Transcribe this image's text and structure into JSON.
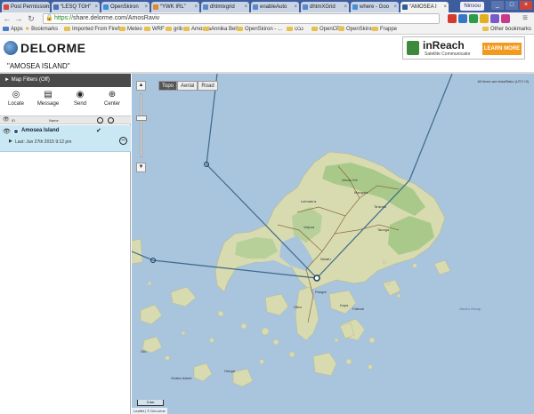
{
  "browser": {
    "tabs": [
      {
        "label": "Post Permissions",
        "color": "#d9463c"
      },
      {
        "label": "“LESQ TGH”",
        "color": "#4a6fb5"
      },
      {
        "label": "OpenSkiron",
        "color": "#3a8fd6"
      },
      {
        "label": "“YWK IRL”",
        "color": "#e08a2a"
      },
      {
        "label": "dhtmlxgrid",
        "color": "#5a88c8"
      },
      {
        "label": "enableAuto",
        "color": "#5a88c8"
      },
      {
        "label": "dhtmXGrid",
        "color": "#5a88c8"
      },
      {
        "label": "where - Goo",
        "color": "#4a8fd6"
      },
      {
        "label": "“AMOSEA I",
        "color": "#2d5d9a",
        "active": true
      }
    ],
    "user": "Ninsou",
    "url_https": "https://",
    "url_rest": "share.delorme.com/AmosRaviv",
    "bookmarks": {
      "apps": "Apps",
      "bookmarks": "Bookmarks",
      "items": [
        "Imported From Firef...",
        "Meteo",
        "WRF",
        "grib",
        "Amosea",
        "Annika Bella",
        "OpenSkiron - ...",
        "נבט",
        "OpenCPN",
        "OpenSkiron",
        "Frappe"
      ],
      "other": "Other bookmarks"
    }
  },
  "site": {
    "logo": "DELORME",
    "ad": {
      "name": "inReach",
      "sub": "Satellite Communicator",
      "cta": "LEARN MORE"
    },
    "title": "\"AMOSEA ISLAND\""
  },
  "panel": {
    "map_filters": "► Map Filters (Off)",
    "actions": [
      {
        "label": "Locate",
        "icon": "◎"
      },
      {
        "label": "Message",
        "icon": "▤"
      },
      {
        "label": "Send",
        "icon": "◉"
      },
      {
        "label": "Center",
        "icon": "⊕"
      }
    ],
    "header_id": "ID",
    "header_name": "Name",
    "device_name": "Amosea Island",
    "device_last": "Last: Jun 27th 2015 9:12 pm"
  },
  "map": {
    "types": [
      "Topo",
      "Aerial",
      "Road"
    ],
    "active_type": "Topo",
    "timezone": "All times are Asia/Baku (UTC+3)",
    "scale": "3 km",
    "attribution": "Leaflet | © DeLorme",
    "places": [
      "Vavau Intl",
      "Mangaia",
      "Leimatu'a",
      "Ta'anea",
      "Taunga",
      "Vaipua",
      "Neiafu",
      "Pangai",
      "Otea",
      "Kapa",
      "Falevai",
      "Vava'u Group",
      "Ovaka Island",
      "Hunga",
      "Ofu"
    ],
    "colors": {
      "sea": "#a9c4dd",
      "land": "#d8dbb0",
      "forest": "#a9c98a",
      "track": "#3c6a8a"
    }
  }
}
